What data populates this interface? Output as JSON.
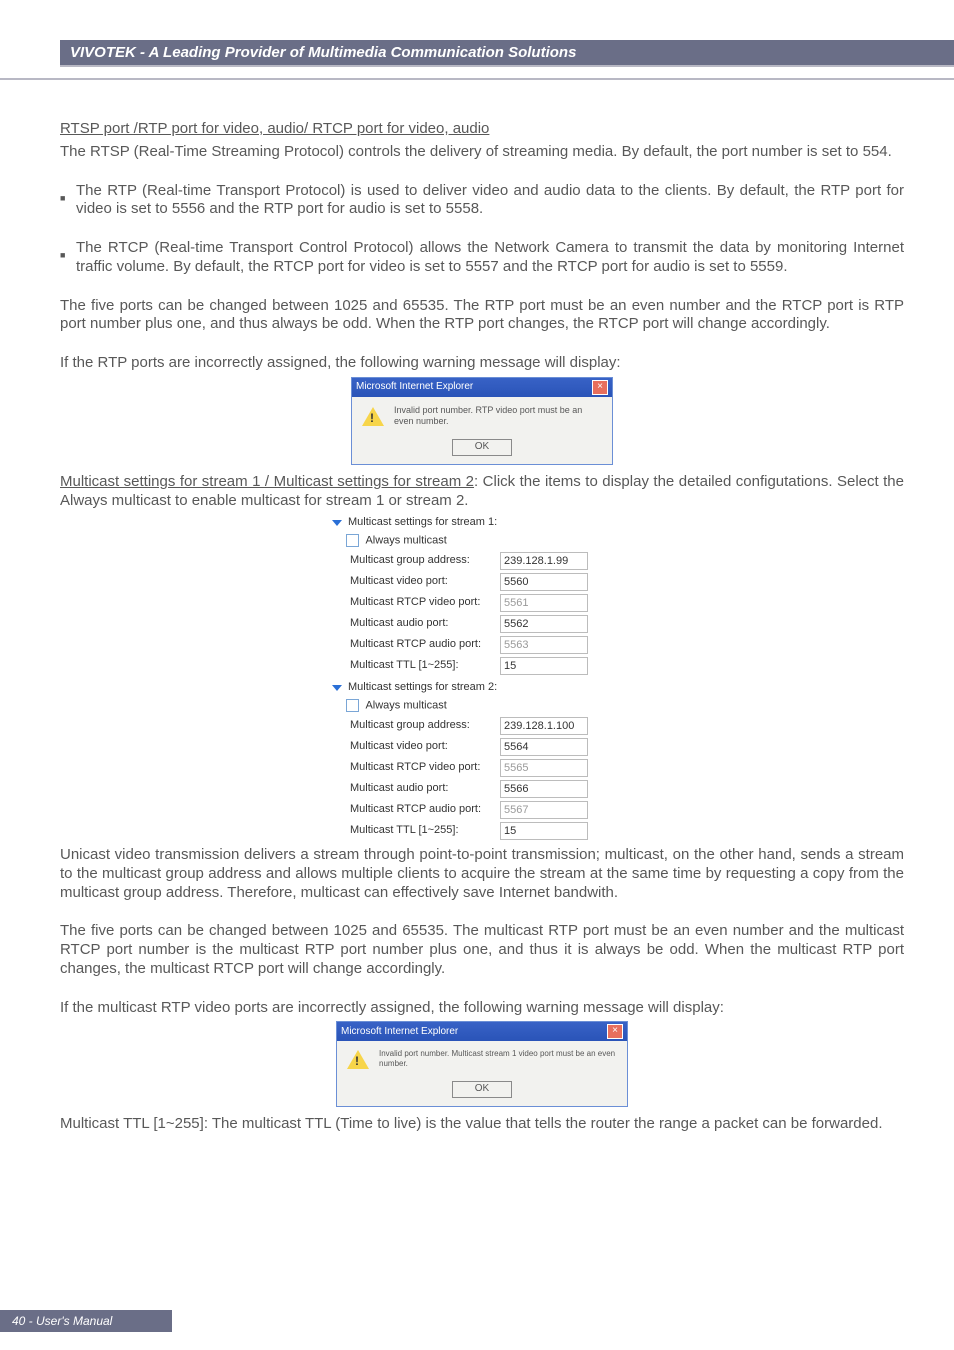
{
  "header": {
    "title": "VIVOTEK - A Leading Provider of Multimedia Communication Solutions"
  },
  "sec1": {
    "heading": "RTSP port /RTP port for video, audio/ RTCP port for video, audio",
    "p1": "The RTSP (Real-Time Streaming Protocol) controls the delivery of streaming media. By default, the port number is set to 554.",
    "b1": "The RTP (Real-time Transport Protocol) is used to deliver video and audio data to the clients. By default, the RTP port for video is set to 5556 and the RTP port for audio is set to 5558.",
    "b2": "The RTCP (Real-time Transport Control Protocol) allows the Network Camera to transmit the data by monitoring Internet traffic volume. By default, the RTCP port for video is set to 5557 and the RTCP port for audio is set to 5559.",
    "p2": "The five ports can be changed between 1025 and 65535. The RTP port must be an even number and the RTCP port is RTP port number plus one, and thus always be odd. When the RTP port changes, the RTCP port will change accordingly.",
    "p3": "If the RTP ports are incorrectly assigned, the following warning message will display:"
  },
  "dlg1": {
    "title": "Microsoft Internet Explorer",
    "msg": "Invalid port number. RTP video port must be an even number.",
    "ok": "OK"
  },
  "sec2": {
    "lead_u": "Multicast settings for stream 1 / Multicast settings for stream 2",
    "lead_rest": ": Click the items to display the detailed configutations. Select the Always multicast to enable multicast for stream 1 or stream 2."
  },
  "mcast": {
    "s1": {
      "title": "Multicast settings for stream 1:",
      "always": "Always multicast",
      "rows": {
        "group_lbl": "Multicast group address:",
        "group_val": "239.128.1.99",
        "vport_lbl": "Multicast video port:",
        "vport_val": "5560",
        "rvport_lbl": "Multicast RTCP video port:",
        "rvport_val": "5561",
        "aport_lbl": "Multicast audio port:",
        "aport_val": "5562",
        "raport_lbl": "Multicast RTCP audio port:",
        "raport_val": "5563",
        "ttl_lbl": "Multicast TTL [1~255]:",
        "ttl_val": "15"
      }
    },
    "s2": {
      "title": "Multicast settings for stream 2:",
      "always": "Always multicast",
      "rows": {
        "group_lbl": "Multicast group address:",
        "group_val": "239.128.1.100",
        "vport_lbl": "Multicast video port:",
        "vport_val": "5564",
        "rvport_lbl": "Multicast RTCP video port:",
        "rvport_val": "5565",
        "aport_lbl": "Multicast audio port:",
        "aport_val": "5566",
        "raport_lbl": "Multicast RTCP audio port:",
        "raport_val": "5567",
        "ttl_lbl": "Multicast TTL [1~255]:",
        "ttl_val": "15"
      }
    }
  },
  "sec3": {
    "p1": "Unicast video transmission delivers a stream through point-to-point transmission; multicast, on the other hand, sends a stream to the multicast group address and allows multiple clients to acquire the stream at the same time by requesting a copy from the multicast group address. Therefore, multicast can effectively save Internet bandwith.",
    "p2": "The five ports can be changed between 1025 and 65535. The multicast RTP port must be an even number and the multicast RTCP port number is the multicast RTP port number plus one, and thus it is always be odd. When the multicast RTP port changes, the multicast RTCP port will change accordingly.",
    "p3": "If the multicast RTP video ports are incorrectly assigned, the following warning message will display:"
  },
  "dlg2": {
    "title": "Microsoft Internet Explorer",
    "msg": "Invalid port number. Multicast stream 1 video port must be an even number.",
    "ok": "OK"
  },
  "sec4": {
    "p1": "Multicast TTL [1~255]: The multicast TTL (Time to live) is the value that tells the router the range a packet can be forwarded."
  },
  "footer": {
    "text": "40 - User's Manual"
  }
}
